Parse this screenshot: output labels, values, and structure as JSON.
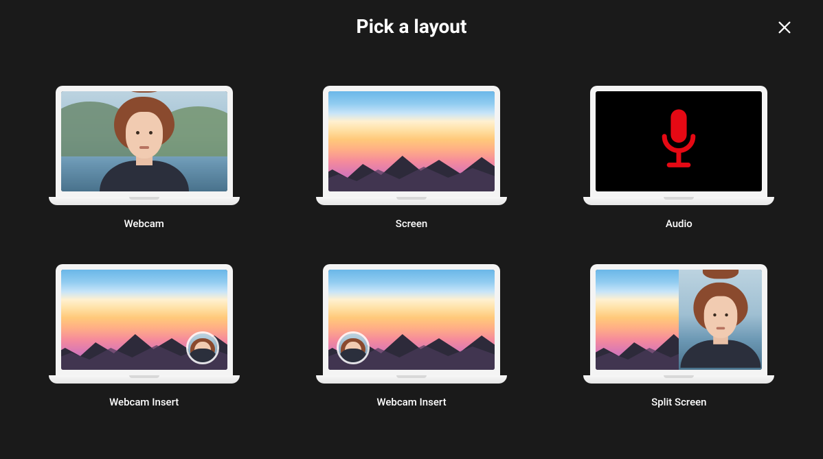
{
  "title": "Pick a layout",
  "close_label": "Close",
  "colors": {
    "accent": "#e50914",
    "bg": "#1a1a1a"
  },
  "options": [
    {
      "id": "webcam",
      "label": "Webcam"
    },
    {
      "id": "screen",
      "label": "Screen"
    },
    {
      "id": "audio",
      "label": "Audio"
    },
    {
      "id": "webcam-insert-right",
      "label": "Webcam Insert"
    },
    {
      "id": "webcam-insert-left",
      "label": "Webcam Insert"
    },
    {
      "id": "split-screen",
      "label": "Split Screen"
    }
  ]
}
